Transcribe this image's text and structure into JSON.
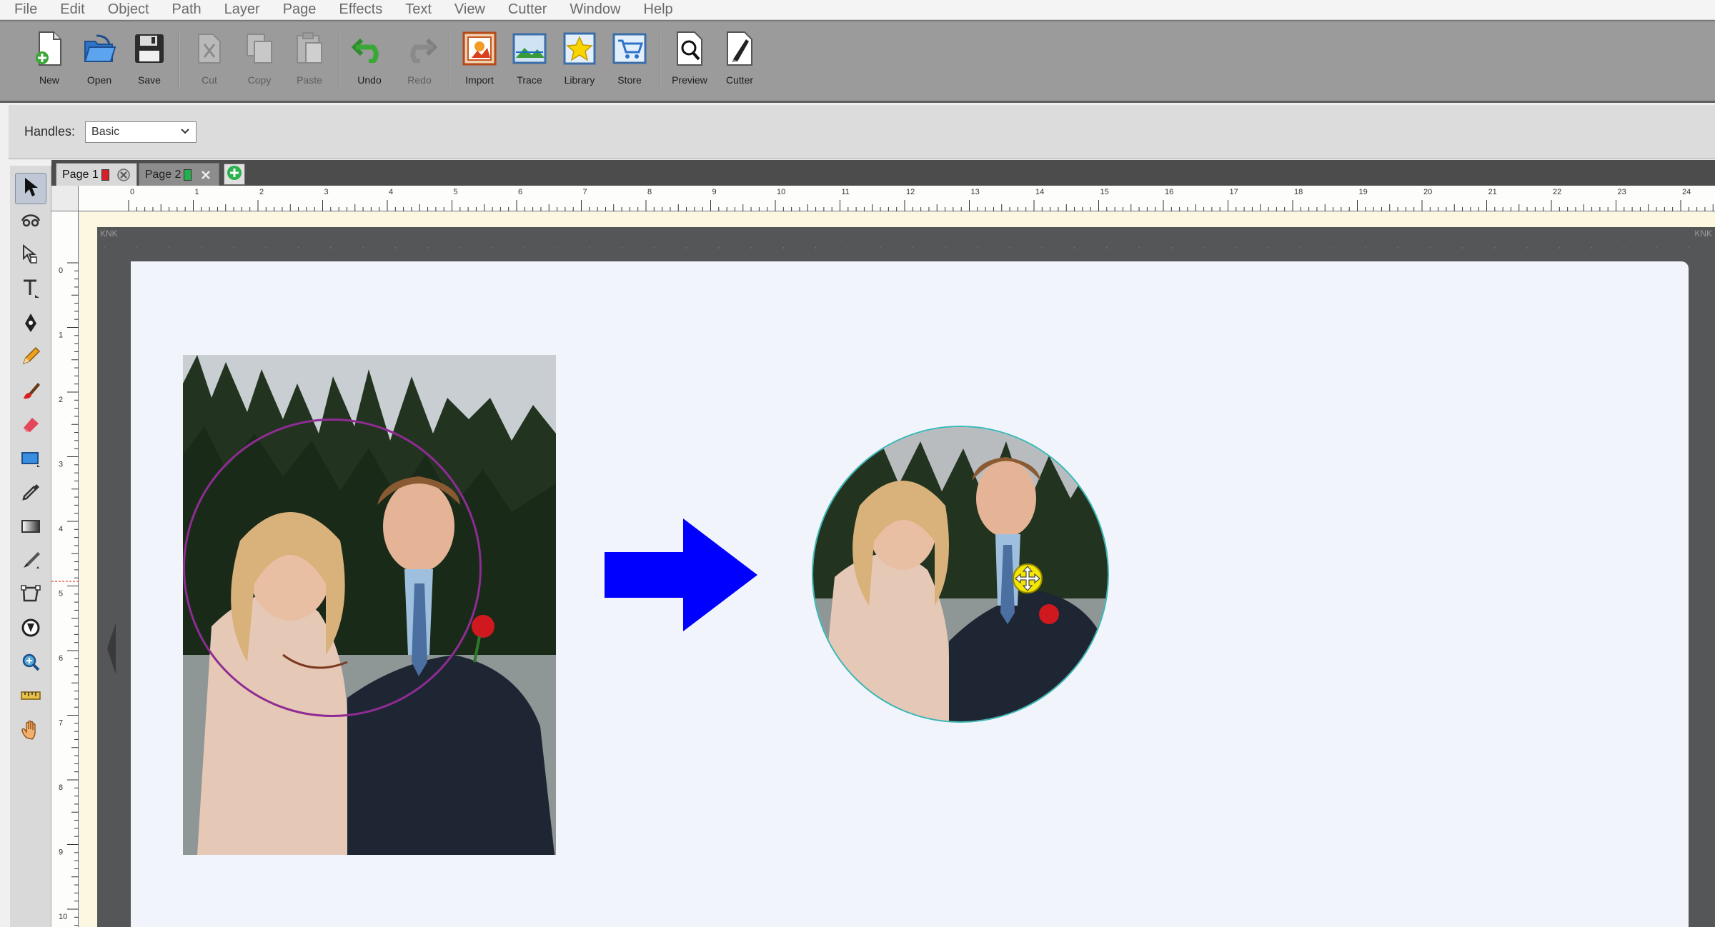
{
  "menu": [
    "File",
    "Edit",
    "Object",
    "Path",
    "Layer",
    "Page",
    "Effects",
    "Text",
    "View",
    "Cutter",
    "Window",
    "Help"
  ],
  "toolbar": {
    "new": "New",
    "open": "Open",
    "save": "Save",
    "cut": "Cut",
    "copy": "Copy",
    "paste": "Paste",
    "undo": "Undo",
    "redo": "Redo",
    "import": "Import",
    "trace": "Trace",
    "library": "Library",
    "store": "Store",
    "preview": "Preview",
    "cutter": "Cutter"
  },
  "options": {
    "handles_label": "Handles:",
    "handles_value": "Basic"
  },
  "tabs": [
    {
      "label": "Page 1",
      "color": "#d4202a"
    },
    {
      "label": "Page 2",
      "color": "#22b14c"
    }
  ],
  "ruler": {
    "h": [
      "0",
      "1",
      "2",
      "3",
      "4",
      "5",
      "6",
      "7",
      "8",
      "9",
      "10",
      "11",
      "12",
      "13",
      "14",
      "15",
      "16",
      "17",
      "18",
      "19",
      "20",
      "21",
      "22",
      "23",
      "24"
    ],
    "v": [
      "0",
      "1",
      "2",
      "3",
      "4",
      "5",
      "6",
      "7",
      "8",
      "9",
      "10"
    ]
  },
  "mat": {
    "left_label": "KNK",
    "right_label": "KNK"
  },
  "colors": {
    "arrow": "#0000ff",
    "crop_circle": "#8e2c94",
    "result_border": "#36b8b5",
    "cursor": "#f3e600"
  }
}
